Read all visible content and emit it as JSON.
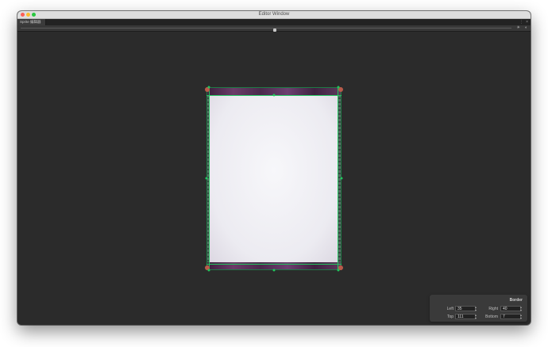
{
  "window": {
    "title": "Editor Window"
  },
  "tab": {
    "label": "Sprite 编辑器",
    "more_icon": "kebab-menu-icon",
    "close_icon": "close-icon"
  },
  "toolbar": {
    "zoom_fraction": 0.5,
    "icons": [
      "brightness-icon",
      "alpha-toggle-icon"
    ]
  },
  "sprite": {
    "colors": {
      "frame": "#55465a",
      "paper": "#f3f2f6",
      "guide": "#22c55e"
    }
  },
  "border_panel": {
    "title": "Border",
    "left_label": "Left",
    "left_value": "35",
    "right_label": "Right",
    "right_value": "40",
    "top_label": "Top",
    "top_value": "111",
    "bottom_label": "Bottom",
    "bottom_value": "7"
  }
}
